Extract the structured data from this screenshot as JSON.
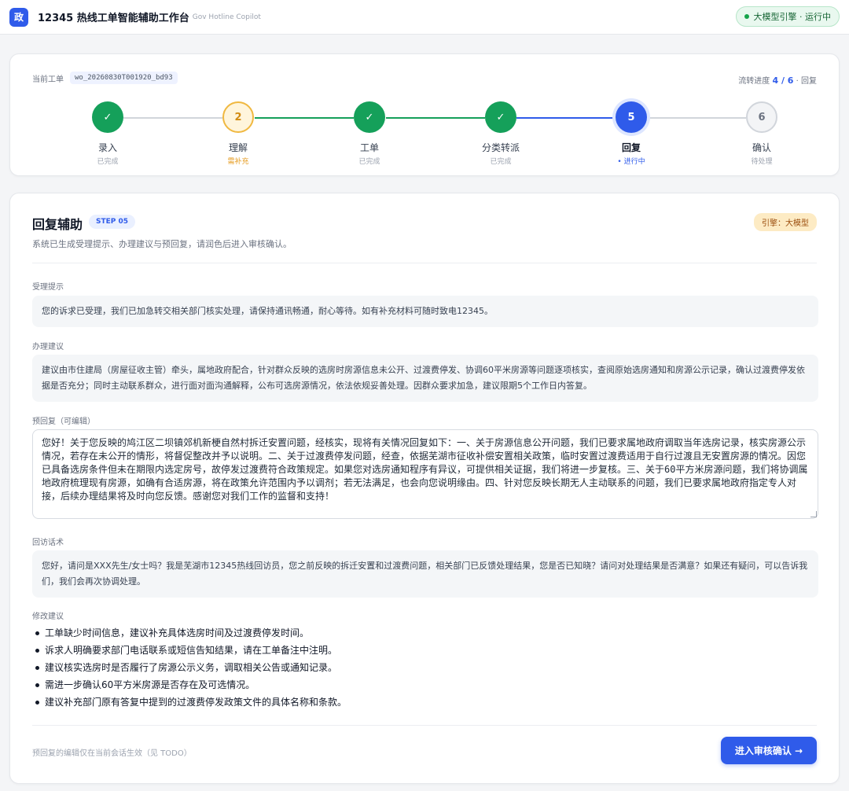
{
  "header": {
    "logo_text": "政",
    "title": "12345 热线工单智能辅助工作台",
    "subtitle": "Gov Hotline Copilot",
    "engine_status": "大模型引擎 · 运行中"
  },
  "progress": {
    "workorder_label": "当前工单",
    "workorder_id": "wo_20260830T001920_bd93",
    "flow_label": "流转进度",
    "flow_value": "4 / 6",
    "flow_suffix": "· 回复",
    "steps": [
      {
        "label": "录入",
        "status": "已完成",
        "state": "done",
        "icon": "check-icon",
        "num": "✓"
      },
      {
        "label": "理解",
        "status": "需补充",
        "state": "warn",
        "icon": "number-icon",
        "num": "2"
      },
      {
        "label": "工单",
        "status": "已完成",
        "state": "done",
        "icon": "check-icon",
        "num": "✓"
      },
      {
        "label": "分类转派",
        "status": "已完成",
        "state": "done",
        "icon": "check-icon",
        "num": "✓"
      },
      {
        "label": "回复",
        "status": "• 进行中",
        "state": "active",
        "icon": "number-icon",
        "num": "5"
      },
      {
        "label": "确认",
        "status": "待处理",
        "state": "pending",
        "icon": "number-icon",
        "num": "6"
      }
    ],
    "colors": {
      "done": "#15a05a",
      "warn": "#f0b840",
      "active": "#2f5bea",
      "pending": "#d1d5db"
    }
  },
  "reply": {
    "title": "回复辅助",
    "step_badge": "STEP 05",
    "engine_badge": "引擎：大模型",
    "description": "系统已生成受理提示、办理建议与预回复，请润色后进入审核确认。",
    "accept_label": "受理提示",
    "accept_text": "您的诉求已受理，我们已加急转交相关部门核实处理，请保持通讯畅通，耐心等待。如有补充材料可随时致电12345。",
    "handle_label": "办理建议",
    "handle_text": "建议由市住建局（房屋征收主管）牵头，属地政府配合，针对群众反映的选房时房源信息未公开、过渡费停发、协调60平米房源等问题逐项核实，查阅原始选房通知和房源公示记录，确认过渡费停发依据是否充分；同时主动联系群众，进行面对面沟通解释，公布可选房源情况，依法依规妥善处理。因群众要求加急，建议限期5个工作日内答复。",
    "draft_label": "预回复（可编辑）",
    "draft_text": "您好！关于您反映的鸠江区二坝镇郊机新梗自然村拆迁安置问题，经核实，现将有关情况回复如下：一、关于房源信息公开问题，我们已要求属地政府调取当年选房记录，核实房源公示情况，若存在未公开的情形，将督促整改并予以说明。二、关于过渡费停发问题，经查，依据芜湖市征收补偿安置相关政策，临时安置过渡费适用于自行过渡且无安置房源的情况。因您已具备选房条件但未在期限内选定房号，故停发过渡费符合政策规定。如果您对选房通知程序有异议，可提供相关证据，我们将进一步复核。三、关于60平方米房源问题，我们将协调属地政府梳理现有房源，如确有合适房源，将在政策允许范围内予以调剂；若无法满足，也会向您说明缘由。四、针对您反映长期无人主动联系的问题，我们已要求属地政府指定专人对接，后续办理结果将及时向您反馈。感谢您对我们工作的监督和支持！",
    "callback_label": "回访话术",
    "callback_text": "您好，请问是XXX先生/女士吗？我是芜湖市12345热线回访员，您之前反映的拆迁安置和过渡费问题，相关部门已反馈处理结果，您是否已知晓？请问对处理结果是否满意？如果还有疑问，可以告诉我们，我们会再次协调处理。",
    "suggest_label": "修改建议",
    "suggestions": [
      "工单缺少时间信息，建议补充具体选房时间及过渡费停发时间。",
      "诉求人明确要求部门电话联系或短信告知结果，请在工单备注中注明。",
      "建议核实选房时是否履行了房源公示义务，调取相关公告或通知记录。",
      "需进一步确认60平方米房源是否存在及可选情况。",
      "建议补充部门原有答复中提到的过渡费停发政策文件的具体名称和条款。"
    ],
    "footnote": "预回复的编辑仅在当前会话生效（见 TODO）",
    "submit_label": "进入审核确认 →"
  }
}
